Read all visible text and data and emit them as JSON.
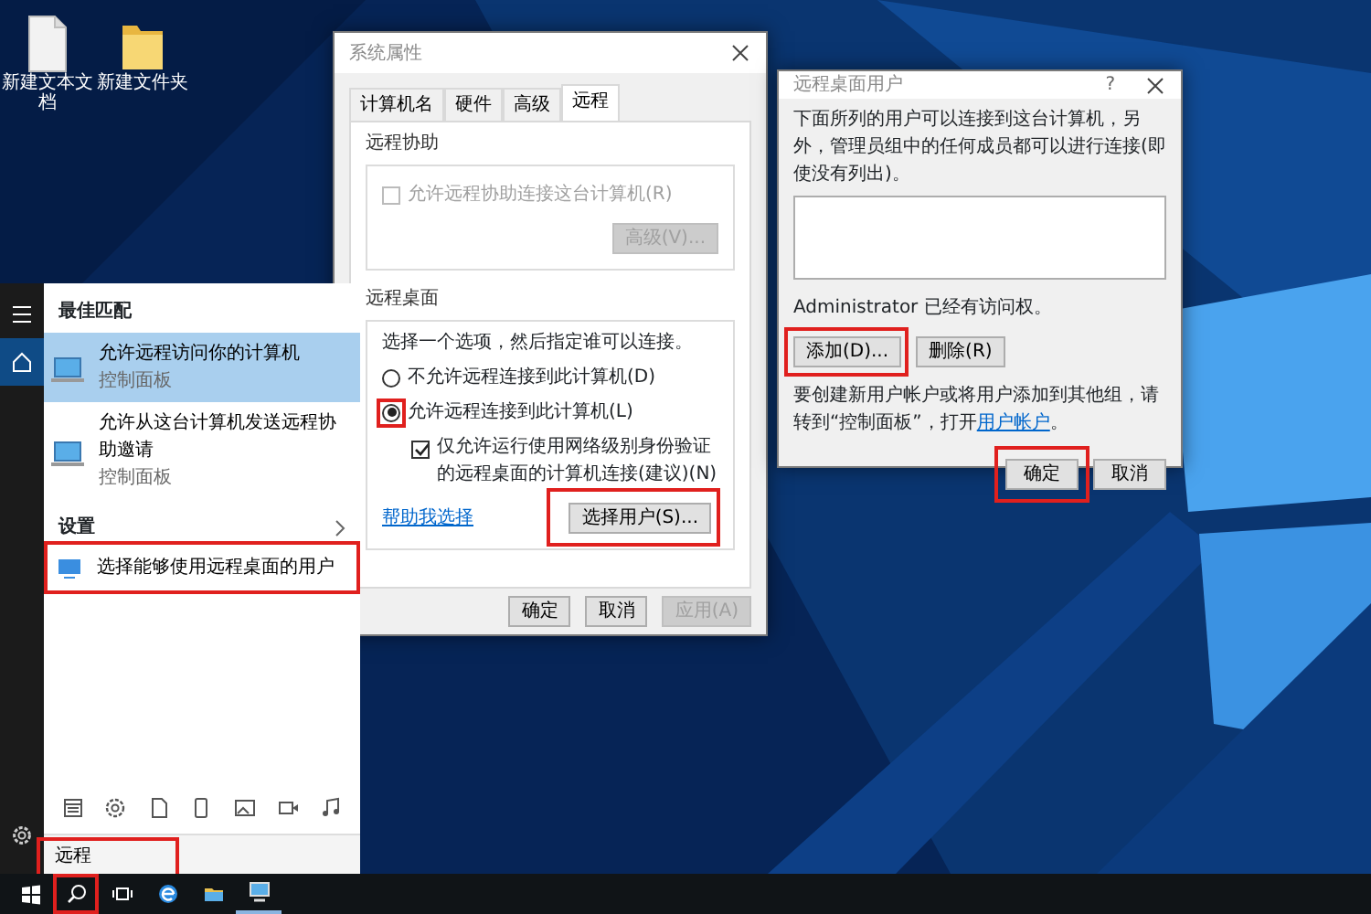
{
  "desktop": {
    "icons": [
      {
        "kind": "text-file",
        "label": "新建文本文档"
      },
      {
        "kind": "folder",
        "label": "新建文件夹"
      }
    ]
  },
  "system_properties": {
    "title": "系统属性",
    "tabs": [
      {
        "label": "计算机名",
        "selected": false
      },
      {
        "label": "硬件",
        "selected": false
      },
      {
        "label": "高级",
        "selected": false
      },
      {
        "label": "远程",
        "selected": true
      }
    ],
    "remote_assistance": {
      "title": "远程协助",
      "checkbox": {
        "label": "允许远程协助连接这台计算机(R)",
        "checked": false,
        "disabled": true
      },
      "advanced_button": {
        "label": "高级(V)...",
        "disabled": true
      }
    },
    "remote_desktop": {
      "title": "远程桌面",
      "hint": "选择一个选项，然后指定谁可以连接。",
      "options": [
        {
          "label": "不允许远程连接到此计算机(D)",
          "selected": false,
          "highlighted": false
        },
        {
          "label": "允许远程连接到此计算机(L)",
          "selected": true,
          "highlighted": true
        }
      ],
      "nla_checkbox": {
        "label": "仅允许运行使用网络级别身份验证的远程桌面的计算机连接(建议)(N)",
        "checked": true
      },
      "help_link": "帮助我选择",
      "select_users_button": {
        "label": "选择用户(S)...",
        "highlighted": true
      }
    },
    "buttons": [
      {
        "label": "确定",
        "disabled": false
      },
      {
        "label": "取消",
        "disabled": false
      },
      {
        "label": "应用(A)",
        "disabled": true
      }
    ]
  },
  "remote_desktop_users": {
    "title": "远程桌面用户",
    "help": "?",
    "description": "下面所列的用户可以连接到这台计算机，另外，管理员组中的任何成员都可以进行连接(即使没有列出)。",
    "admin_note": "Administrator 已经有访问权。",
    "user_buttons": [
      {
        "label": "添加(D)...",
        "highlighted": true
      },
      {
        "label": "删除(R)",
        "highlighted": false
      }
    ],
    "footer_text": "要创建新用户帐户或将用户添加到其他组，请转到“控制面板”，打开",
    "footer_link": "用户帐户",
    "footer_end": "。",
    "buttons": [
      {
        "label": "确定",
        "highlighted": true
      },
      {
        "label": "取消",
        "highlighted": false
      }
    ]
  },
  "start_menu": {
    "rail": [
      {
        "kind": "menu",
        "selected": false
      },
      {
        "kind": "home",
        "selected": true
      },
      {
        "kind": "settings",
        "selected": false
      }
    ],
    "best_match_header": "最佳匹配",
    "results": [
      {
        "title": "允许远程访问你的计算机",
        "subtitle": "控制面板",
        "selected": true
      },
      {
        "title": "允许从这台计算机发送远程协助邀请",
        "subtitle": "控制面板",
        "selected": false
      }
    ],
    "settings_header": "设置",
    "settings_results": [
      {
        "title": "选择能够使用远程桌面的用户",
        "highlighted": true
      }
    ],
    "filters": [
      {
        "kind": "apps"
      },
      {
        "kind": "settings"
      },
      {
        "kind": "documents"
      },
      {
        "kind": "phone"
      },
      {
        "kind": "photos"
      },
      {
        "kind": "videos"
      },
      {
        "kind": "music"
      }
    ],
    "search": {
      "value": "远程",
      "highlighted": true
    }
  },
  "taskbar": {
    "items": [
      {
        "kind": "start",
        "highlighted": false,
        "active": false
      },
      {
        "kind": "search",
        "highlighted": true,
        "active": false
      },
      {
        "kind": "task-view",
        "highlighted": false,
        "active": false
      },
      {
        "kind": "browser",
        "highlighted": false,
        "active": false
      },
      {
        "kind": "file-explorer",
        "highlighted": false,
        "active": false
      },
      {
        "kind": "system-properties",
        "highlighted": false,
        "active": true
      }
    ]
  }
}
